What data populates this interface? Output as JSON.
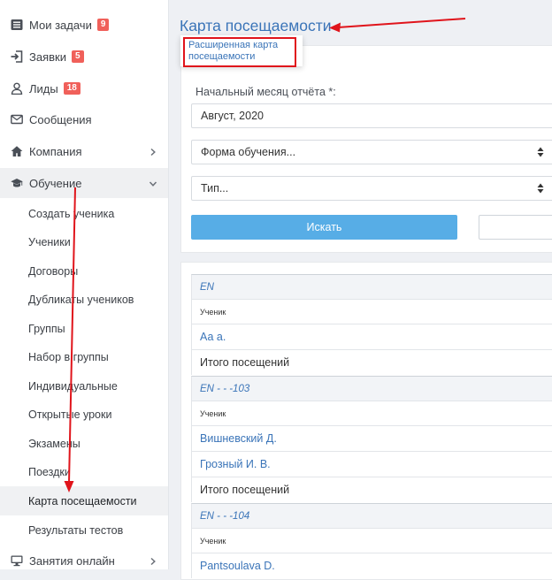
{
  "sidebar": {
    "items": [
      {
        "label": "Мои задачи",
        "badge": "9",
        "icon": "tasks-icon"
      },
      {
        "label": "Заявки",
        "badge": "5",
        "icon": "sign-in-icon"
      },
      {
        "label": "Лиды",
        "badge": "18",
        "icon": "user-icon"
      },
      {
        "label": "Сообщения",
        "icon": "envelope-icon"
      },
      {
        "label": "Компания",
        "icon": "home-icon"
      },
      {
        "label": "Обучение",
        "icon": "graduation-cap-icon"
      }
    ],
    "sub_items": [
      "Создать ученика",
      "Ученики",
      "Договоры",
      "Дубликаты учеников",
      "Группы",
      "Набор в группы",
      "Индивидуальные",
      "Открытые уроки",
      "Экзамены",
      "Поездки",
      "Карта посещаемости",
      "Результаты тестов"
    ],
    "bottom_item": {
      "label": "Занятия онлайн",
      "icon": "monitor-icon"
    }
  },
  "page": {
    "title": "Карта посещаемости",
    "popup_link": "Расширенная карта посещаемости"
  },
  "filters": {
    "start_month_label": "Начальный месяц отчёта *:",
    "start_month_value": "Август, 2020",
    "study_form_placeholder": "Форма обучения...",
    "type_placeholder": "Тип...",
    "search_button": "Искать"
  },
  "table": {
    "groups": [
      {
        "name": "EN",
        "header": "Ученик",
        "students": [
          "Аа а."
        ],
        "total": "Итого посещений"
      },
      {
        "name": "EN - - -103",
        "header": "Ученик",
        "students": [
          "Вишневский Д.",
          "Грозный И. В."
        ],
        "total": "Итого посещений"
      },
      {
        "name": "EN - - -104",
        "header": "Ученик",
        "students": [
          "Pantsoulava D."
        ]
      }
    ]
  },
  "colors": {
    "accent": "#3a74b8",
    "button": "#57ade6",
    "badge": "#f0605a",
    "annotation": "#e0141b"
  }
}
